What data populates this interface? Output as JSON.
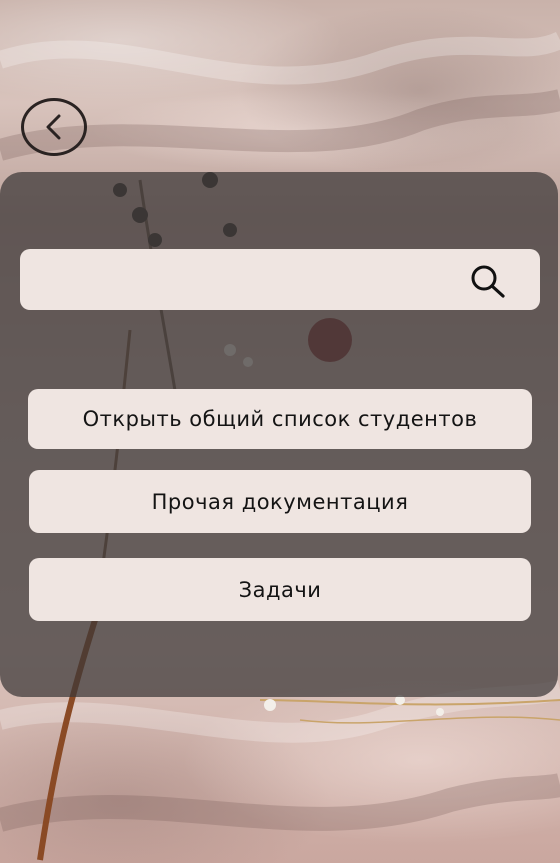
{
  "navigation": {
    "back_icon": "chevron-left-icon"
  },
  "search": {
    "value": "",
    "placeholder": "",
    "icon": "search-icon"
  },
  "menu": {
    "items": [
      {
        "label": "Открыть общий список студентов"
      },
      {
        "label": "Прочая документация"
      },
      {
        "label": "Задачи"
      }
    ]
  },
  "colors": {
    "panel_overlay": "#3c3737",
    "button_background": "#efe5e1",
    "text": "#141414",
    "icon_stroke": "#2a2322"
  }
}
